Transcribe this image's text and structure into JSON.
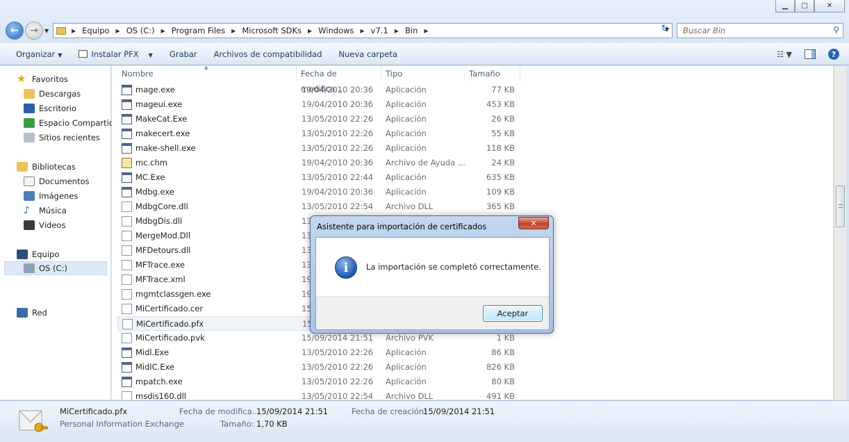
{
  "window": {
    "minimize": "▁",
    "maximize": "□",
    "close": "✕"
  },
  "address": {
    "segments": [
      "Equipo",
      "OS (C:)",
      "Program Files",
      "Microsoft SDKs",
      "Windows",
      "v7.1",
      "Bin"
    ],
    "search_placeholder": "Buscar Bin"
  },
  "toolbar": {
    "organize": "Organizar",
    "install_pfx": "Instalar PFX",
    "burn": "Grabar",
    "compat_files": "Archivos de compatibilidad",
    "new_folder": "Nueva carpeta"
  },
  "nav": {
    "favorites": "Favoritos",
    "downloads": "Descargas",
    "desktop": "Escritorio",
    "shared": "Espacio Compartic",
    "recent": "Sitios recientes",
    "libraries": "Bibliotecas",
    "documents": "Documentos",
    "images": "Imágenes",
    "music": "Música",
    "videos": "Vídeos",
    "computer": "Equipo",
    "drive": "OS (C:)",
    "network": "Red"
  },
  "columns": {
    "name": "Nombre",
    "date": "Fecha de modifica...",
    "type": "Tipo",
    "size": "Tamaño"
  },
  "files": [
    {
      "name": "mage.exe",
      "date": "19/04/2010 20:36",
      "type": "Aplicación",
      "size": "77 KB"
    },
    {
      "name": "mageui.exe",
      "date": "19/04/2010 20:36",
      "type": "Aplicación",
      "size": "453 KB"
    },
    {
      "name": "MakeCat.Exe",
      "date": "13/05/2010 22:26",
      "type": "Aplicación",
      "size": "26 KB"
    },
    {
      "name": "makecert.exe",
      "date": "13/05/2010 22:26",
      "type": "Aplicación",
      "size": "55 KB"
    },
    {
      "name": "make-shell.exe",
      "date": "13/05/2010 22:26",
      "type": "Aplicación",
      "size": "118 KB"
    },
    {
      "name": "mc.chm",
      "date": "19/04/2010 20:36",
      "type": "Archivo de Ayuda ...",
      "size": "24 KB"
    },
    {
      "name": "MC.Exe",
      "date": "13/05/2010 22:44",
      "type": "Aplicación",
      "size": "635 KB"
    },
    {
      "name": "Mdbg.exe",
      "date": "19/04/2010 20:36",
      "type": "Aplicación",
      "size": "109 KB"
    },
    {
      "name": "MdbgCore.dll",
      "date": "13/05/2010 22:54",
      "type": "Archivo DLL",
      "size": "365 KB"
    },
    {
      "name": "MdbgDis.dll",
      "date": "13",
      "type": "",
      "size": ""
    },
    {
      "name": "MergeMod.Dll",
      "date": "13",
      "type": "",
      "size": ""
    },
    {
      "name": "MFDetours.dll",
      "date": "13",
      "type": "",
      "size": ""
    },
    {
      "name": "MFTrace.exe",
      "date": "13",
      "type": "",
      "size": ""
    },
    {
      "name": "MFTrace.xml",
      "date": "19",
      "type": "",
      "size": ""
    },
    {
      "name": "mgmtclassgen.exe",
      "date": "19",
      "type": "",
      "size": ""
    },
    {
      "name": "MiCertificado.cer",
      "date": "15",
      "type": "",
      "size": ""
    },
    {
      "name": "MiCertificado.pfx",
      "date": "15",
      "type": "",
      "size": ""
    },
    {
      "name": "MiCertificado.pvk",
      "date": "15/09/2014 21:51",
      "type": "Archivo PVK",
      "size": "1 KB"
    },
    {
      "name": "Midl.Exe",
      "date": "13/05/2010 22:26",
      "type": "Aplicación",
      "size": "86 KB"
    },
    {
      "name": "MidlC.Exe",
      "date": "13/05/2010 22:26",
      "type": "Aplicación",
      "size": "826 KB"
    },
    {
      "name": "mpatch.exe",
      "date": "13/05/2010 22:26",
      "type": "Aplicación",
      "size": "80 KB"
    },
    {
      "name": "msdis160.dll",
      "date": "13/05/2010 22:54",
      "type": "Archivo DLL",
      "size": "491 KB"
    }
  ],
  "details": {
    "filename": "MiCertificado.pfx",
    "filetype": "Personal Information Exchange",
    "modified_label": "Fecha de modifica...",
    "modified_value": "15/09/2014 21:51",
    "created_label": "Fecha de creación:",
    "created_value": "15/09/2014 21:51",
    "size_label": "Tamaño:",
    "size_value": "1,70 KB"
  },
  "dialog": {
    "title": "Asistente para importación de certificados",
    "close": "✕",
    "message": "La importación se completó correctamente.",
    "ok": "Aceptar",
    "icon_glyph": "i"
  }
}
